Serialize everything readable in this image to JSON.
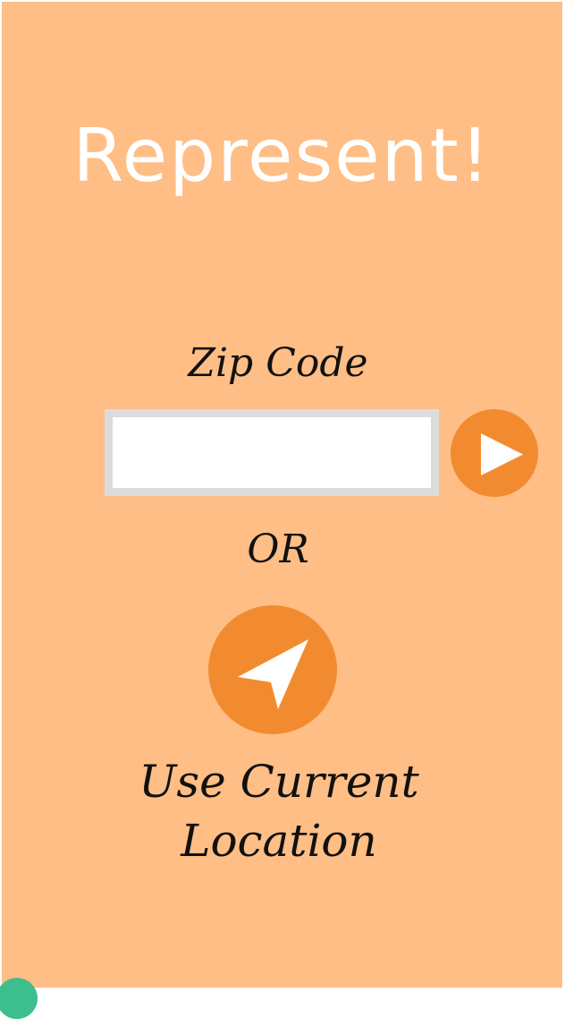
{
  "app": {
    "title": "Represent!"
  },
  "zip": {
    "label": "Zip Code",
    "value": "",
    "placeholder": "",
    "submit_icon": "play-icon"
  },
  "divider": {
    "label": "OR"
  },
  "location": {
    "icon": "navigation-arrow-icon",
    "label": "Use Current Location"
  },
  "colors": {
    "background": "#FFBE85",
    "accent": "#F28B30",
    "input_border": "#DCDCDC",
    "text_dark": "#111111",
    "title": "#FFFFFF"
  }
}
